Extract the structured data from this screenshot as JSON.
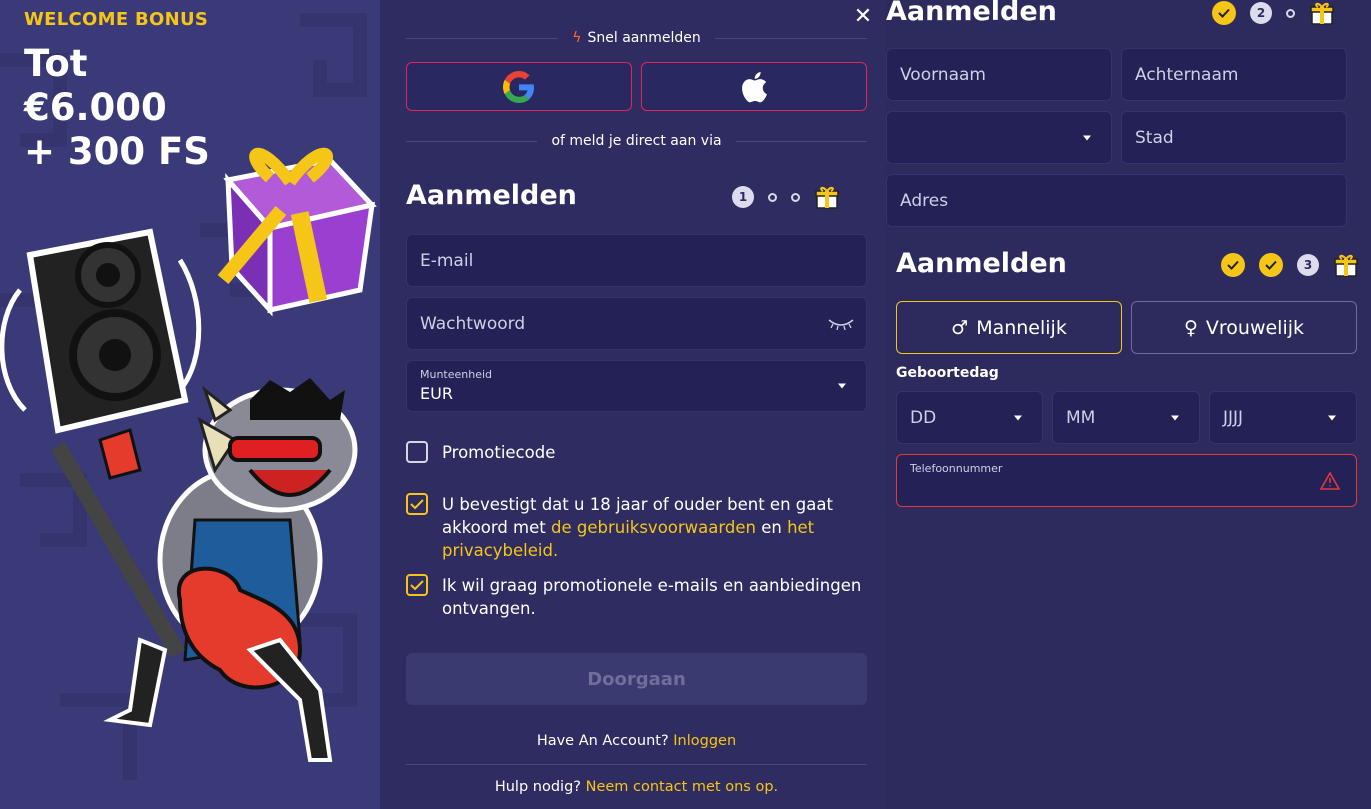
{
  "promo": {
    "kicker": "WELCOME BONUS",
    "title": "Tot\n€6.000\n+ 300 FS"
  },
  "quick": {
    "label": "Snel aanmelden",
    "google": "google-icon",
    "apple": "apple-icon",
    "or_label": "of meld je direct aan via"
  },
  "step1": {
    "heading": "Aanmelden",
    "step_number": "1",
    "email_placeholder": "E-mail",
    "password_placeholder": "Wachtwoord",
    "currency_label": "Munteenheid",
    "currency_value": "EUR",
    "promo_label": "Promotiecode",
    "terms_prefix": "U bevestigt dat u 18 jaar of ouder bent en gaat akkoord met ",
    "terms_link": "de gebruiksvoorwaarden",
    "terms_mid": " en ",
    "privacy_link": "het privacybeleid.",
    "marketing_label": "Ik wil graag promotionele e-mails en aanbiedingen ontvangen.",
    "continue_label": "Doorgaan",
    "have_account": "Have An Account? ",
    "login_link": "Inloggen",
    "help": "Hulp nodig? ",
    "contact_link": "Neem contact met ons op."
  },
  "step2": {
    "heading": "Aanmelden",
    "step_number": "2",
    "first_name": "Voornaam",
    "last_name": "Achternaam",
    "city": "Stad",
    "address": "Adres"
  },
  "step3": {
    "heading": "Aanmelden",
    "step_number": "3",
    "male": "Mannelijk",
    "female": "Vrouwelijk",
    "birthday_label": "Geboortedag",
    "dd": "DD",
    "mm": "MM",
    "yyyy": "JJJJ",
    "phone_label": "Telefoonnummer"
  },
  "colors": {
    "accent": "#f5c518",
    "error": "#e03a3a",
    "brand_red": "#e0245e"
  }
}
